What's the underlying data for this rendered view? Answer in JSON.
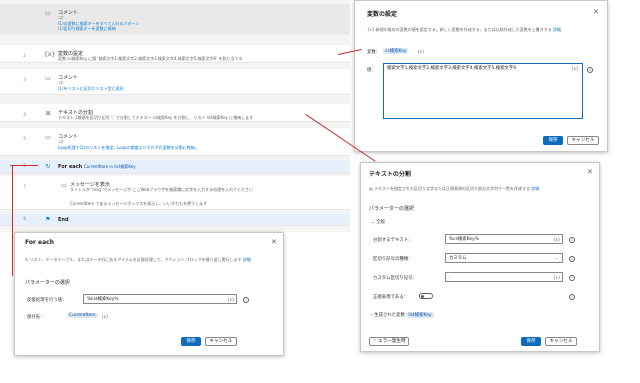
{
  "flow": {
    "rows": [
      {
        "num": "",
        "icon": "comment-icon",
        "title": "コメント",
        "lines": [
          "コ）",
          "(1)の変数に検索キーをすべて入れるパターン",
          "(1)区切り検索キーを変数に格納"
        ]
      },
      {
        "num": "2",
        "icon": "variable-icon",
        "title": "変数の設定",
        "lines": [
          "変数 cs検索Key に値 '検索文字1,検索文字2,検索文字3,検索文字4,検索文字5,検索文字6' を割り当てる"
        ]
      },
      {
        "num": "3",
        "icon": "comment-icon",
        "title": "コメント",
        "lines": [
          "コ）",
          "(1)をリストに区切りリスト型に変形"
        ]
      },
      {
        "num": "4",
        "icon": "split-text-icon",
        "title": "テキストの分割",
        "lines": [
          "テキスト 1数値を区切り記号 ',' で分割してテキスト cs検索Key を分割し、リスト list検索Key に格納します"
        ]
      },
      {
        "num": "5",
        "icon": "comment-icon",
        "title": "コメント",
        "lines": [
          "コ）",
          "Loop処理で(2)のリストを指定。Loopの都度よりそれぞれ変数を分割に格納。"
        ]
      },
      {
        "num": "6",
        "icon": "loop-icon",
        "title": "For each",
        "lines": [
          "CurrentItem in list検索Key"
        ]
      },
      {
        "num": "7",
        "icon": "message-icon",
        "title": "メッセージを表示",
        "lines": [
          "タイトルが 'msg' でメッセージが ここWebブラウザを検索欄に文字を入力する処理を入れてください",
          "CurrentItem であるメッセージボックスを表示し、いいずれもを押下します"
        ]
      },
      {
        "num": "8",
        "icon": "end-flag-icon",
        "title": "End",
        "lines": []
      }
    ]
  },
  "set_variable_panel": {
    "title": "変数の設定",
    "description": "新規の既存の変数の値を設定する。新しい変数を作成する、または以前作成した変数を上書きする",
    "description_link": "詳細",
    "variable_label": "変数：",
    "variable_value": "cs検索Key",
    "variable_suffix": "{x}",
    "value_label": "値：",
    "value_text": "検索文字1,検索文字2,検索文字3,検索文字4,検索文字5,検索文字6",
    "value_fx": "{x}",
    "save_label": "保存",
    "cancel_label": "キャンセル"
  },
  "split_text_panel": {
    "title": "テキストの分割",
    "description": "テキストを指定された区切り文字または正規表現の区切り部分文字列で一覧を作成する",
    "description_link": "詳細",
    "params_heading": "パラメーターの選択",
    "general_heading": "全般",
    "fields": [
      {
        "label": "分割するテキスト：",
        "value": "%cs検索Key%",
        "suffix": "{x}"
      },
      {
        "label": "区切り記号の種類：",
        "value": "カスタム",
        "suffix": ""
      },
      {
        "label": "カスタム区切り記号：",
        "value": ",",
        "suffix": "{x}"
      },
      {
        "label": "正規表現である：",
        "value": "",
        "suffix": ""
      }
    ],
    "generated_label": "生成された変数",
    "generated_value": "list検索Key",
    "error_button": "エラー発生時",
    "save_label": "保存",
    "cancel_label": "キャンセル"
  },
  "for_each_panel": {
    "title": "For each",
    "description": "リスト、データテーブル、またはデータ行にあるアイテムを反復処理して、アクション ブロックを繰り返し実行します",
    "description_link": "詳細",
    "params_heading": "パラメーターの選択",
    "iterate_label": "反復処理を行う値：",
    "iterate_value": "%list検索Key%",
    "iterate_suffix": "{x}",
    "store_label": "保存先：",
    "store_value": "CurrentItem",
    "store_suffix": "{x}",
    "save_label": "保存",
    "cancel_label": "キャンセル"
  },
  "colors": {
    "accent": "#0f6cbd",
    "annotation": "#c72e2e"
  }
}
